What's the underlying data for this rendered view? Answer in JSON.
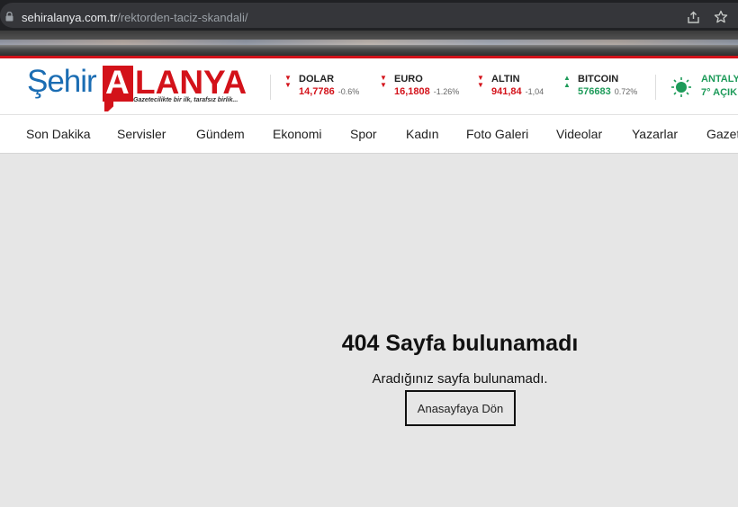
{
  "browser": {
    "url_domain": "sehiralanya.com.tr",
    "url_path": "/rektorden-taciz-skandali/"
  },
  "logo": {
    "part1": "Şehir",
    "part2_first": "A",
    "part2_rest": "LANYA",
    "tagline": "Gazetecilikte bir ilk, tarafsız birlik..."
  },
  "tickers": [
    {
      "name": "DOLAR",
      "value": "14,7786",
      "change": "-0.6%",
      "trend": "down"
    },
    {
      "name": "EURO",
      "value": "16,1808",
      "change": "-1.26%",
      "trend": "down"
    },
    {
      "name": "ALTIN",
      "value": "941,84",
      "change": "-1,04",
      "trend": "down"
    },
    {
      "name": "BITCOIN",
      "value": "576683",
      "change": "0.72%",
      "trend": "up"
    }
  ],
  "weather": {
    "city": "ANTALY",
    "temp": "7° AÇIK"
  },
  "nav": {
    "items": [
      "Son Dakika",
      "Servisler",
      "Gündem",
      "Ekonomi",
      "Spor",
      "Kadın",
      "Foto Galeri",
      "Videolar",
      "Yazarlar",
      "Gazet"
    ]
  },
  "error": {
    "title": "404 Sayfa bulunamadı",
    "message": "Aradığınız sayfa bulunamadı.",
    "button": "Anasayfaya Dön"
  },
  "colors": {
    "brand_red": "#d3121a",
    "brand_blue": "#1b6db3",
    "up_green": "#1e9b5a"
  }
}
